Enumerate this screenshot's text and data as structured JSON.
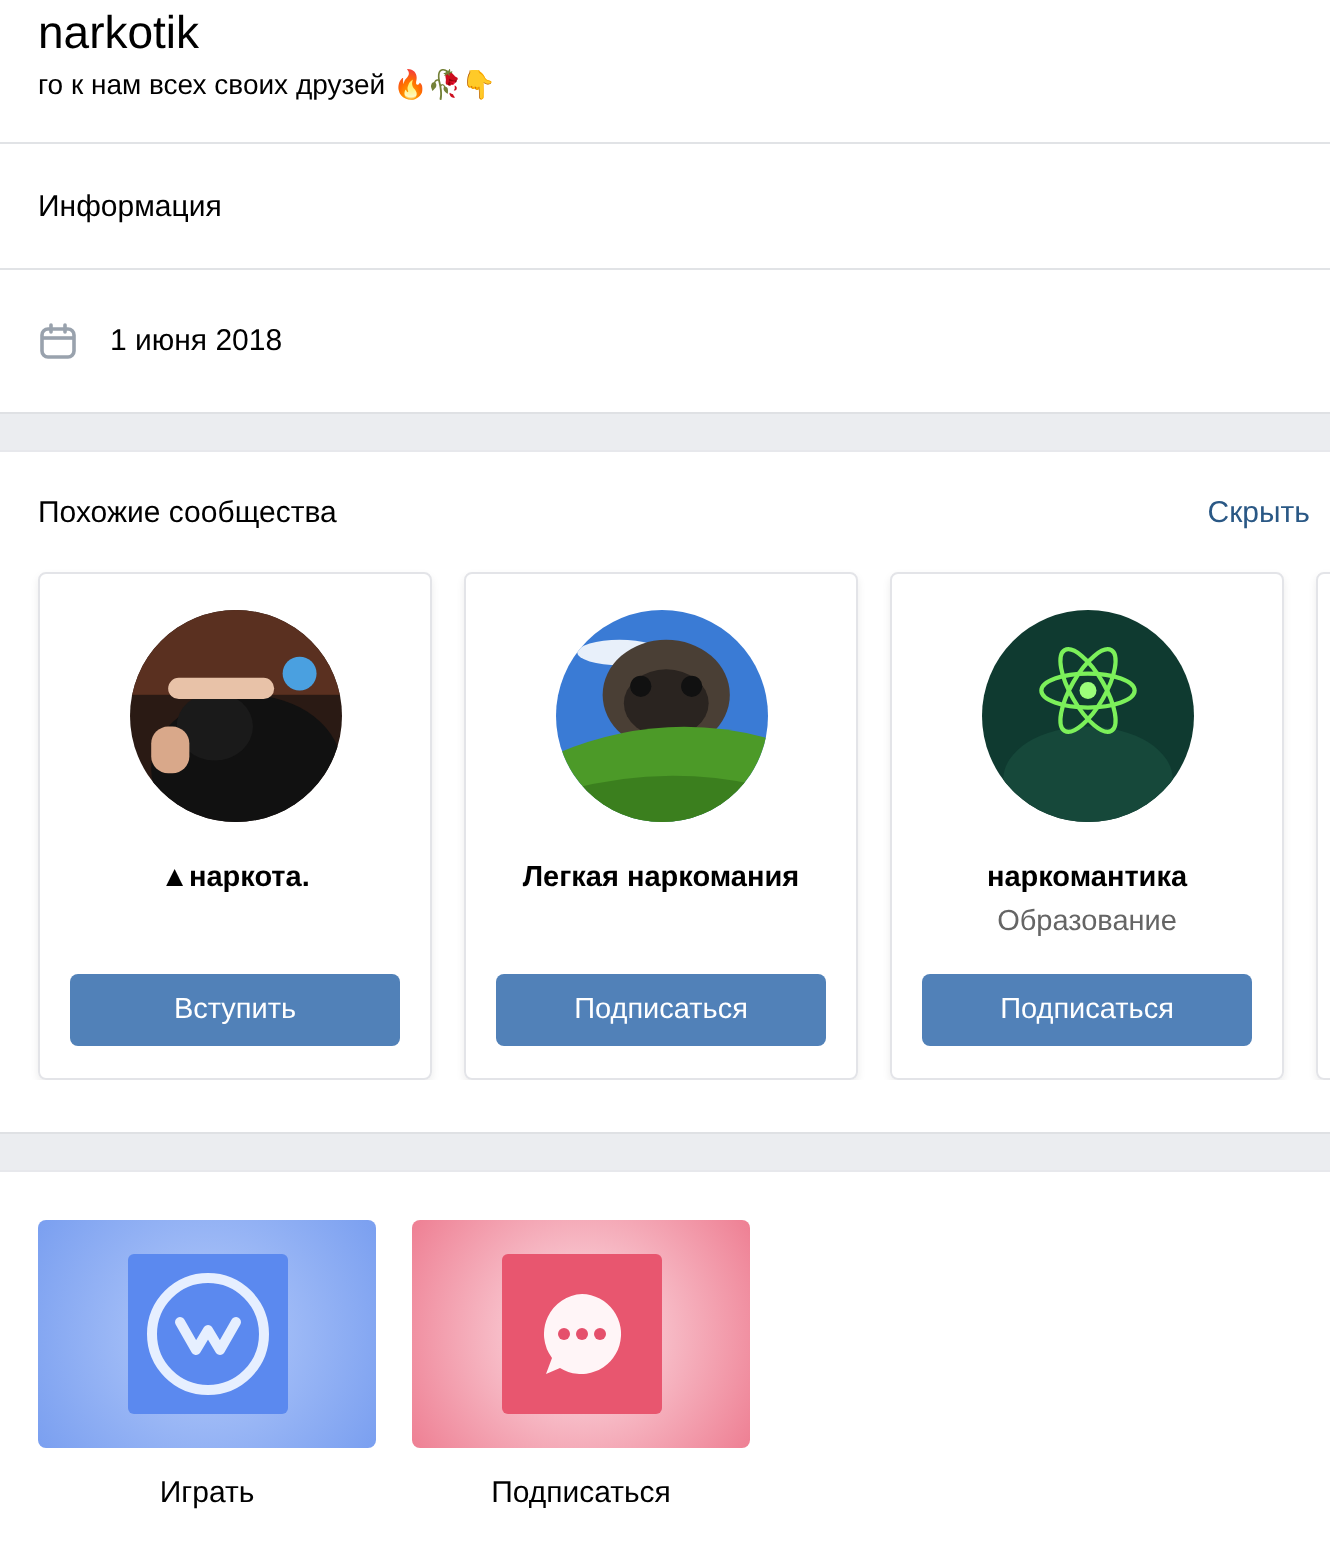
{
  "header": {
    "title": "narkotik",
    "status": "го к нам всех своих друзей 🔥🥀👇"
  },
  "info": {
    "label": "Информация"
  },
  "date": {
    "text": "1 июня 2018"
  },
  "similar": {
    "title": "Похожие сообщества",
    "hide": "Скрыть",
    "communities": [
      {
        "name": "▲наркота.",
        "button": "Вступить"
      },
      {
        "name": "Легкая наркомания",
        "button": "Подписаться"
      },
      {
        "name": "наркомантика",
        "category": "Образование",
        "button": "Подписаться"
      }
    ]
  },
  "apps": [
    {
      "label": "Играть",
      "kind": "game"
    },
    {
      "label": "Подписаться",
      "kind": "messages"
    }
  ]
}
